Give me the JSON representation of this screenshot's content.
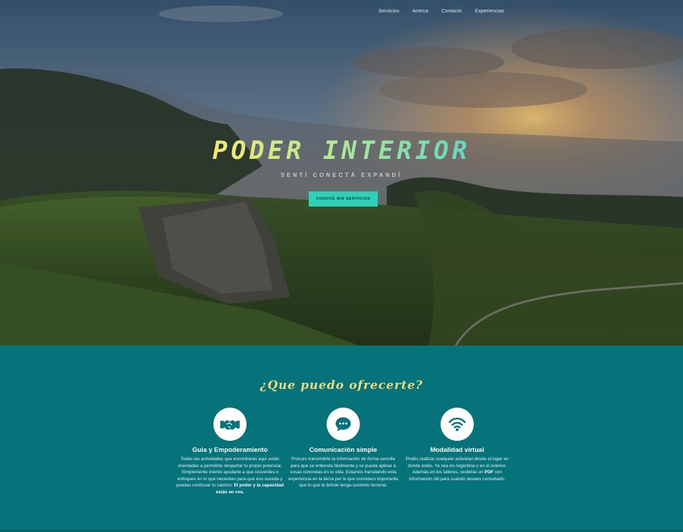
{
  "nav": {
    "items": [
      "Servicios",
      "Acerca",
      "Contacto",
      "Experiencias"
    ]
  },
  "hero": {
    "title": "PODER INTERIOR",
    "subtitle": "SENTÍ CONECTÁ EXPANDÍ",
    "cta_label": "CONOCÉ MIS SERVICIOS"
  },
  "services": {
    "heading": "¿Que puedo ofrecerte?",
    "cards": [
      {
        "icon": "handshake-icon",
        "title": "Guia y Empoderamiento",
        "text": "Todas las actividades que encontrarás aquí están orientadas a permitirte despertar tu propio potencial. Simplemente intento ayudarte a que recuerdes o enfoques en lo que necesites para que eso suceda y puedas continuar tu camino.",
        "text_bold": "El poder y la capacidad están en vos."
      },
      {
        "icon": "chat-bubble-icon",
        "title": "Comunicación simple",
        "text_a": "Procuro transmitirte la información de",
        "text_em": "forma sencilla",
        "text_b": "para que se entienda fácilmente y se pueda aplicar a cosas concretas en tu vida. Estamos transitando esta experiencia en la tierra por lo que considero importante que lo que te brinde tenga sustento terrenal."
      },
      {
        "icon": "wifi-icon",
        "title": "Modalidad virtual",
        "text_a": "Podés realizar cualquier actividad desde el lugar en donde estés. Ya sea en Argentina o en el exterior. Además,en los talleres, recibirás un",
        "text_bold": "PDF",
        "text_b": "con información útil para cuando desees consultarlo."
      }
    ]
  },
  "colors": {
    "section_bg": "#06727a",
    "cta_bg": "#2fd0b5",
    "heading": "#f2d87a"
  }
}
